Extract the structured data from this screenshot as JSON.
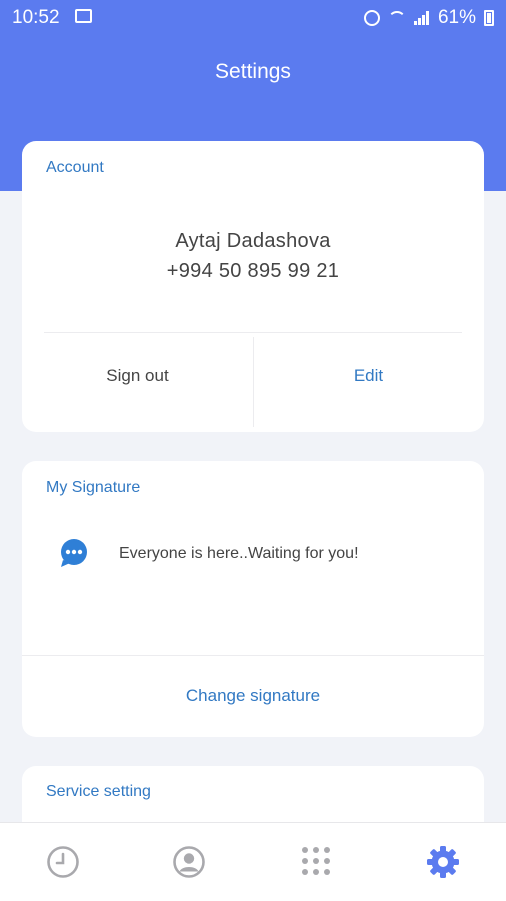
{
  "status_bar": {
    "time": "10:52",
    "battery": "61%"
  },
  "header": {
    "title": "Settings"
  },
  "account": {
    "label": "Account",
    "name": "Aytaj Dadashova",
    "phone": "+994 50 895 99 21",
    "sign_out": "Sign out",
    "edit": "Edit"
  },
  "signature": {
    "label": "My Signature",
    "text": "Everyone is here..Waiting for you!",
    "change": "Change signature"
  },
  "service": {
    "label": "Service setting"
  },
  "bottom_nav": {
    "items": [
      {
        "icon": "clock-icon",
        "active": false
      },
      {
        "icon": "person-icon",
        "active": false
      },
      {
        "icon": "dialpad-icon",
        "active": false
      },
      {
        "icon": "gear-icon",
        "active": true
      }
    ]
  },
  "colors": {
    "accent": "#5b7bef",
    "link": "#3279c3",
    "inactive": "#a9a9ad"
  }
}
